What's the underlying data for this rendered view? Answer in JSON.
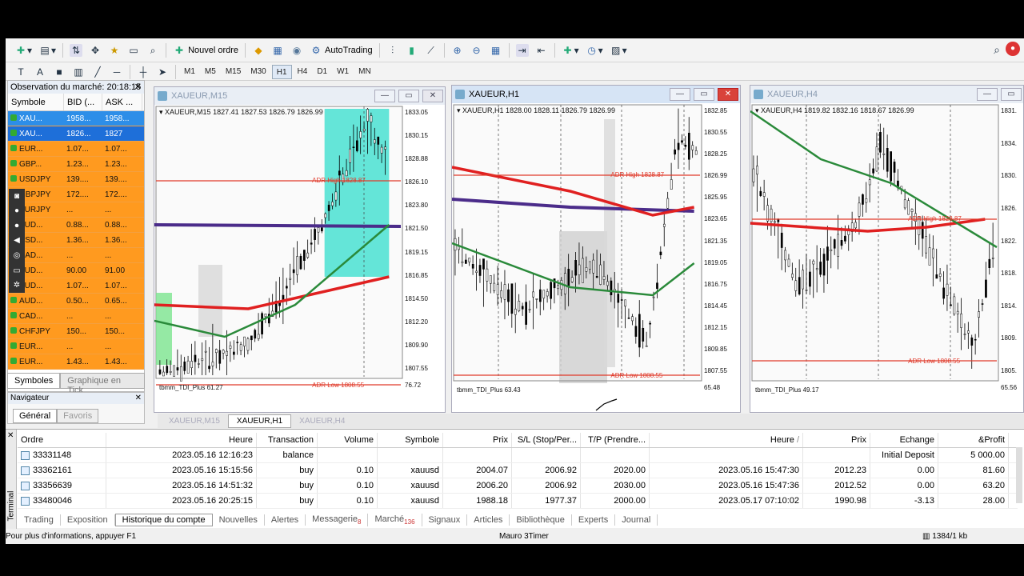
{
  "toolbar": {
    "new_order": "Nouvel ordre",
    "autotrading": "AutoTrading"
  },
  "timeframes": [
    "M1",
    "M5",
    "M15",
    "M30",
    "H1",
    "H4",
    "D1",
    "W1",
    "MN"
  ],
  "active_timeframe": "H1",
  "market_watch": {
    "title": "Observation du marché: 20:18:15",
    "col_symbol": "Symbole",
    "col_bid": "BID (...",
    "col_ask": "ASK ...",
    "rows": [
      {
        "sym": "XAU...",
        "bid": "1958...",
        "ask": "1958...",
        "style": "blue2"
      },
      {
        "sym": "XAU...",
        "bid": "1826...",
        "ask": "1827",
        "style": "blue"
      },
      {
        "sym": "EUR...",
        "bid": "1.07...",
        "ask": "1.07...",
        "style": "orange"
      },
      {
        "sym": "GBP...",
        "bid": "1.23...",
        "ask": "1.23...",
        "style": "orange"
      },
      {
        "sym": "USDJPY",
        "bid": "139....",
        "ask": "139....",
        "style": "orange"
      },
      {
        "sym": "GBPJPY",
        "bid": "172....",
        "ask": "172....",
        "style": "orange"
      },
      {
        "sym": "EURJPY",
        "bid": "...",
        "ask": "...",
        "style": "orange"
      },
      {
        "sym": "AUD...",
        "bid": "0.88...",
        "ask": "0.88...",
        "style": "orange"
      },
      {
        "sym": "USD...",
        "bid": "1.36...",
        "ask": "1.36...",
        "style": "orange"
      },
      {
        "sym": "CAD...",
        "bid": "...",
        "ask": "...",
        "style": "orange"
      },
      {
        "sym": "AUD...",
        "bid": "90.00",
        "ask": "91.00",
        "style": "orange"
      },
      {
        "sym": "AUD...",
        "bid": "1.07...",
        "ask": "1.07...",
        "style": "orange"
      },
      {
        "sym": "AUD...",
        "bid": "0.50...",
        "ask": "0.65...",
        "style": "orange"
      },
      {
        "sym": "CAD...",
        "bid": "...",
        "ask": "...",
        "style": "orange"
      },
      {
        "sym": "CHFJPY",
        "bid": "150...",
        "ask": "150...",
        "style": "orange"
      },
      {
        "sym": "EUR...",
        "bid": "...",
        "ask": "...",
        "style": "orange"
      },
      {
        "sym": "EUR...",
        "bid": "1.43...",
        "ask": "1.43...",
        "style": "orange"
      }
    ],
    "tab_symbols": "Symboles",
    "tab_tick_chart": "Graphique en Tick"
  },
  "navigator": {
    "title": "Navigateur",
    "tab_general": "Général",
    "tab_favorites": "Favoris"
  },
  "charts": [
    {
      "title": "XAUEUR,M15",
      "header": "XAUEUR,M15  1827.41 1827.53 1826.79 1826.99",
      "prices": [
        "1833.05",
        "1830.15",
        "1828.88",
        "1826.10",
        "1823.80",
        "1821.50",
        "1819.15",
        "1816.85",
        "1814.50",
        "1812.20",
        "1809.90",
        "1807.55"
      ],
      "adr_high": "ADR High 1828.87",
      "adr_low": "ADR Low 1808.55",
      "osc_label": "tbmm_TDI_Plus 61.27",
      "osc_value": "76.72"
    },
    {
      "title": "XAUEUR,H1",
      "header": "XAUEUR,H1  1828.00 1828.11 1826.79 1826.99",
      "prices": [
        "1832.85",
        "1830.55",
        "1828.25",
        "1826.99",
        "1825.95",
        "1823.65",
        "1821.35",
        "1819.05",
        "1816.75",
        "1814.45",
        "1812.15",
        "1809.85",
        "1807.55"
      ],
      "adr_high": "ADR High 1828.87",
      "adr_low": "ADR Low 1808.55",
      "osc_label": "tbmm_TDI_Plus 63.43",
      "osc_value": "65.48"
    },
    {
      "title": "XAUEUR,H4",
      "header": "XAUEUR,H4  1819.82 1832.16 1818.67 1826.99",
      "prices": [
        "1831.",
        "1834.",
        "1830.",
        "1826.",
        "1822.",
        "1818.",
        "1814.",
        "1809.",
        "1805."
      ],
      "adr_high": "ADR High 1828.87",
      "adr_low": "ADR Low 1808.55",
      "osc_label": "tbmm_TDI_Plus 49.17",
      "osc_value": "65.56"
    }
  ],
  "chart_tabs": [
    "XAUEUR,M15",
    "XAUEUR,H1",
    "XAUEUR,H4"
  ],
  "terminal": {
    "side_label": "Terminal",
    "headers": [
      "Ordre",
      "Heure",
      "Transaction",
      "Volume",
      "Symbole",
      "Prix",
      "S/L (Stop/Per...",
      "T/P (Prendre...",
      "Heure",
      "Prix",
      "Echange",
      "&Profit"
    ],
    "rows": [
      {
        "order": "33331148",
        "time": "2023.05.16 12:16:23",
        "type": "balance",
        "vol": "",
        "sym": "",
        "price": "",
        "sl": "",
        "tp": "",
        "time2": "",
        "price2": "",
        "swap": "Initial Deposit",
        "profit": "5 000.00"
      },
      {
        "order": "33362161",
        "time": "2023.05.16 15:15:56",
        "type": "buy",
        "vol": "0.10",
        "sym": "xauusd",
        "price": "2004.07",
        "sl": "2006.92",
        "tp": "2020.00",
        "time2": "2023.05.16 15:47:30",
        "price2": "2012.23",
        "swap": "0.00",
        "profit": "81.60"
      },
      {
        "order": "33356639",
        "time": "2023.05.16 14:51:32",
        "type": "buy",
        "vol": "0.10",
        "sym": "xauusd",
        "price": "2006.20",
        "sl": "2006.92",
        "tp": "2030.00",
        "time2": "2023.05.16 15:47:36",
        "price2": "2012.52",
        "swap": "0.00",
        "profit": "63.20"
      },
      {
        "order": "33480046",
        "time": "2023.05.16 20:25:15",
        "type": "buy",
        "vol": "0.10",
        "sym": "xauusd",
        "price": "1988.18",
        "sl": "1977.37",
        "tp": "2000.00",
        "time2": "2023.05.17 07:10:02",
        "price2": "1990.98",
        "swap": "-3.13",
        "profit": "28.00"
      }
    ],
    "tabs": [
      {
        "label": "Trading"
      },
      {
        "label": "Exposition"
      },
      {
        "label": "Historique du compte",
        "active": true
      },
      {
        "label": "Nouvelles"
      },
      {
        "label": "Alertes"
      },
      {
        "label": "Messagerie",
        "badge": "8"
      },
      {
        "label": "Marché",
        "badge": "136"
      },
      {
        "label": "Signaux"
      },
      {
        "label": "Articles"
      },
      {
        "label": "Bibliothèque"
      },
      {
        "label": "Experts"
      },
      {
        "label": "Journal"
      }
    ]
  },
  "status_bar": {
    "help": "Pour plus d'informations, appuyer F1",
    "profile": "Mauro 3Timer",
    "traffic": "1384/1 kb"
  },
  "colors": {
    "orange": "#ff9a1f",
    "blue": "#1e6fd9",
    "adr_line": "#e03a2a",
    "ma_purple": "#4b2c8a",
    "ma_green": "#2a8a3a",
    "ma_red": "#e02020",
    "zone": "#3fe0d0"
  }
}
